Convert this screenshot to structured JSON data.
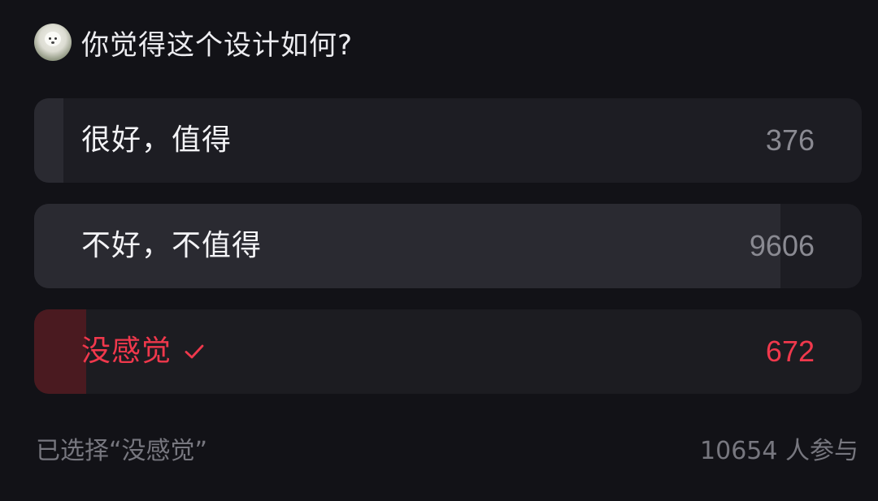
{
  "poll": {
    "question": "你觉得这个设计如何?",
    "options": [
      {
        "label": "很好，值得",
        "count": "376",
        "fraction": 0.035,
        "selected": false
      },
      {
        "label": "不好，不值得",
        "count": "9606",
        "fraction": 0.902,
        "selected": false
      },
      {
        "label": "没感觉",
        "count": "672",
        "fraction": 0.063,
        "selected": true
      }
    ],
    "selected_text": "已选择“没感觉”",
    "participants_text": "10654 人参与"
  },
  "colors": {
    "background": "#121217",
    "option_bg": "#1d1d23",
    "bar_fill": "#2a2a31",
    "selected_bar_fill": "#4a1a20",
    "accent_red": "#f0384c",
    "muted_text": "#77777f"
  },
  "icons": {
    "avatar": "dog-avatar",
    "selected_marker": "check-icon"
  }
}
